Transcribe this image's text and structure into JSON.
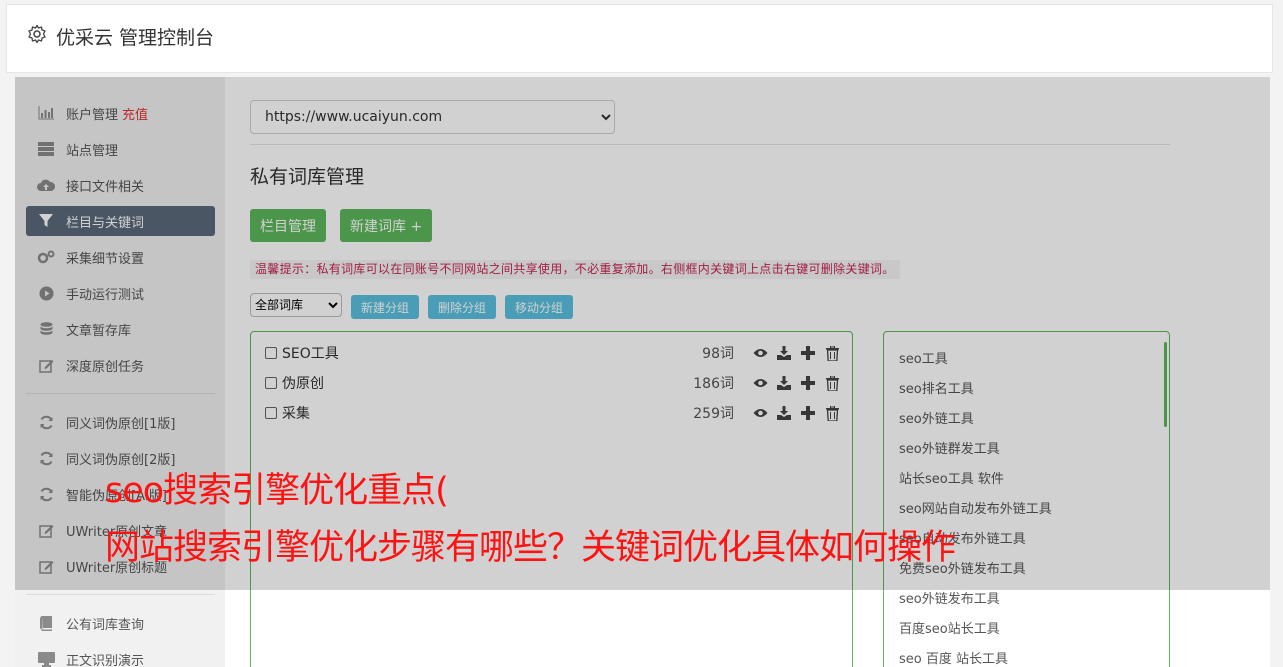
{
  "header": {
    "title": "优采云 管理控制台",
    "icon": "gear-icon"
  },
  "sidebar": {
    "items": [
      {
        "label": "账户管理",
        "icon": "bar-chart-icon",
        "extra": "充值"
      },
      {
        "label": "站点管理",
        "icon": "server-icon"
      },
      {
        "label": "接口文件相关",
        "icon": "cloud-upload-icon"
      },
      {
        "label": "栏目与关键词",
        "icon": "filter-icon",
        "active": true
      },
      {
        "label": "采集细节设置",
        "icon": "cogs-icon"
      },
      {
        "label": "手动运行测试",
        "icon": "play-circle-icon"
      },
      {
        "label": "文章暂存库",
        "icon": "database-icon"
      },
      {
        "label": "深度原创任务",
        "icon": "edit-icon"
      },
      {
        "label": "同义词伪原创[1版]",
        "icon": "refresh-icon"
      },
      {
        "label": "同义词伪原创[2版]",
        "icon": "refresh-icon"
      },
      {
        "label": "智能伪原创[AI版]",
        "icon": "refresh-icon"
      },
      {
        "label": "UWriter原创文章",
        "icon": "edit-icon"
      },
      {
        "label": "UWriter原创标题",
        "icon": "edit-icon"
      },
      {
        "label": "公有词库查询",
        "icon": "book-icon"
      },
      {
        "label": "正文识别演示",
        "icon": "monitor-icon"
      }
    ]
  },
  "main": {
    "site_select": "https://www.ucaiyun.com",
    "page_title": "私有词库管理",
    "btn_columns": "栏目管理",
    "btn_new_lib": "新建词库 +",
    "tip": "温馨提示：私有词库可以在同账号不同网站之间共享使用，不必重复添加。右侧框内关键词上点击右键可删除关键词。",
    "lib_select": "全部词库",
    "btn_new_group": "新建分组",
    "btn_delete_group": "删除分组",
    "btn_move_group": "移动分组",
    "groups": [
      {
        "name": "SEO工具",
        "count": "98词"
      },
      {
        "name": "伪原创",
        "count": "186词"
      },
      {
        "name": "采集",
        "count": "259词"
      }
    ],
    "keywords": [
      "seo工具",
      "seo排名工具",
      "seo外链工具",
      "seo外链群发工具",
      "站长seo工具 软件",
      "seo网站自动发布外链工具",
      "seo自动发布外链工具",
      "免费seo外链发布工具",
      "seo外链发布工具",
      "百度seo站长工具",
      "seo 百度 站长工具"
    ]
  },
  "overlay": {
    "line1": "seo搜索引擎优化重点(",
    "line2": "网站搜索引擎优化步骤有哪些？关键词优化具体如何操作"
  },
  "colors": {
    "accent_green": "#5cb85c",
    "accent_blue": "#5bc0de",
    "active_nav": "#5b6a7a",
    "overlay_text": "#ff1212",
    "tip_text": "#c7254e"
  }
}
